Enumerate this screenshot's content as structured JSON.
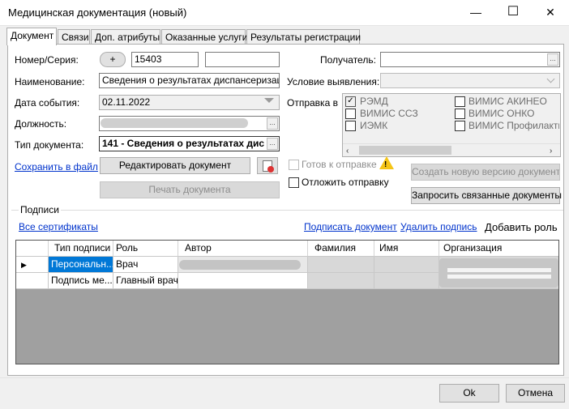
{
  "window": {
    "title": "Медицинская документация (новый)",
    "minimize_glyph": "—",
    "maximize_glyph": "☐",
    "close_glyph": "✕"
  },
  "tabs": [
    {
      "label": "Документ",
      "active": true
    },
    {
      "label": "Связи"
    },
    {
      "label": "Доп. атрибуты"
    },
    {
      "label": "Оказанные услуги"
    },
    {
      "label": "Результаты регистрации"
    }
  ],
  "form": {
    "number_label": "Номер/Серия:",
    "plus_button": "+",
    "number_value": "15403",
    "series_value": "",
    "name_label": "Наименование:",
    "name_value": "Сведения о результатах диспансеризации",
    "date_label": "Дата события:",
    "date_value": "02.11.2022",
    "position_label": "Должность:",
    "doctype_label": "Тип документа:",
    "doctype_value": "141 - Сведения о результатах дис",
    "save_to_file": "Сохранить в файл",
    "edit_button": "Редактировать документ",
    "print_button": "Печать документа",
    "ellipsis": "...",
    "recipient_label": "Получатель:",
    "condition_label": "Условие выявления:",
    "send_to_label": "Отправка в",
    "send_targets": [
      {
        "label": "РЭМД",
        "checked": true
      },
      {
        "label": "ВИМИС АКИНЕО",
        "checked": false
      },
      {
        "label": "ВИМИС ССЗ",
        "checked": false
      },
      {
        "label": "ВИМИС ОНКО",
        "checked": false
      },
      {
        "label": "ИЭМК",
        "checked": false
      },
      {
        "label": "ВИМИС Профилактик",
        "checked": false
      }
    ],
    "ready_to_send": "Готов к отправке",
    "postpone_send": "Отложить отправку",
    "new_version_button": "Создать новую версию документ",
    "request_related_button": "Запросить связанные документы",
    "warning_glyph": "!"
  },
  "signatures": {
    "group_label": "Подписи",
    "all_certs": "Все сертификаты",
    "sign_doc": "Подписать документ",
    "delete_sign": "Удалить подпись",
    "add_role": "Добавить роль",
    "columns": [
      "Тип подписи",
      "Роль",
      "Автор",
      "Фамилия",
      "Имя",
      "Организация"
    ],
    "rows": [
      {
        "type": "Персональн...",
        "role": "Врач",
        "current": true
      },
      {
        "type": "Подпись ме...",
        "role": "Главный врач",
        "current": false
      }
    ],
    "row_pointer": "▶"
  },
  "footer": {
    "ok": "Ok",
    "cancel": "Отмена"
  }
}
